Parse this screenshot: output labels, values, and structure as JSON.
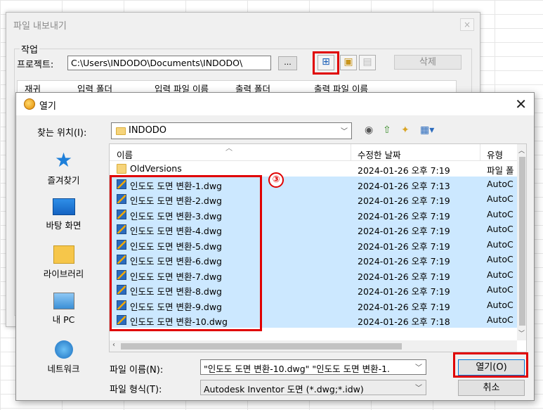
{
  "export_dialog": {
    "title": "파일 내보내기",
    "close_symbol": "×",
    "group_label": "작업",
    "project_label": "프로젝트:",
    "project_path": "C:\\Users\\INDODO\\Documents\\INDODO\\",
    "browse_label": "...",
    "delete_label": "삭제",
    "columns": [
      "재귀",
      "입력 폴더",
      "입력 파일 이름",
      "출력 폴더",
      "출력 파일 이름"
    ]
  },
  "open_dialog": {
    "title": "열기",
    "close_symbol": "✕",
    "lookin_label": "찾는 위치(I):",
    "lookin_value": "INDODO",
    "places": [
      {
        "label": "즐겨찾기",
        "icon": "star-icon"
      },
      {
        "label": "바탕 화면",
        "icon": "desktop-icon"
      },
      {
        "label": "라이브러리",
        "icon": "library-icon"
      },
      {
        "label": "내 PC",
        "icon": "computer-icon"
      },
      {
        "label": "네트워크",
        "icon": "network-icon"
      }
    ],
    "columns": {
      "name": "이름",
      "date": "수정한 날짜",
      "type": "유형"
    },
    "files": [
      {
        "name": "OldVersions",
        "date": "2024-01-26 오후 7:19",
        "type": "파일 폴",
        "kind": "folder",
        "selected": false
      },
      {
        "name": "인도도 도면 변환-1.dwg",
        "date": "2024-01-26 오후 7:13",
        "type": "AutoC",
        "kind": "dwg",
        "selected": true
      },
      {
        "name": "인도도 도면 변환-2.dwg",
        "date": "2024-01-26 오후 7:19",
        "type": "AutoC",
        "kind": "dwg",
        "selected": true
      },
      {
        "name": "인도도 도면 변환-3.dwg",
        "date": "2024-01-26 오후 7:19",
        "type": "AutoC",
        "kind": "dwg",
        "selected": true
      },
      {
        "name": "인도도 도면 변환-4.dwg",
        "date": "2024-01-26 오후 7:19",
        "type": "AutoC",
        "kind": "dwg",
        "selected": true
      },
      {
        "name": "인도도 도면 변환-5.dwg",
        "date": "2024-01-26 오후 7:19",
        "type": "AutoC",
        "kind": "dwg",
        "selected": true
      },
      {
        "name": "인도도 도면 변환-6.dwg",
        "date": "2024-01-26 오후 7:19",
        "type": "AutoC",
        "kind": "dwg",
        "selected": true
      },
      {
        "name": "인도도 도면 변환-7.dwg",
        "date": "2024-01-26 오후 7:19",
        "type": "AutoC",
        "kind": "dwg",
        "selected": true
      },
      {
        "name": "인도도 도면 변환-8.dwg",
        "date": "2024-01-26 오후 7:19",
        "type": "AutoC",
        "kind": "dwg",
        "selected": true
      },
      {
        "name": "인도도 도면 변환-9.dwg",
        "date": "2024-01-26 오후 7:19",
        "type": "AutoC",
        "kind": "dwg",
        "selected": true
      },
      {
        "name": "인도도 도면 변환-10.dwg",
        "date": "2024-01-26 오후 7:18",
        "type": "AutoC",
        "kind": "dwg",
        "selected": true
      }
    ],
    "filename_label": "파일 이름(N):",
    "filename_value": "\"인도도 도면 변환-10.dwg\" \"인도도 도면 변환-1.",
    "filetype_label": "파일 형식(T):",
    "filetype_value": "Autodesk Inventor 도면 (*.dwg;*.idw)",
    "open_label": "열기(O)",
    "cancel_label": "취소"
  },
  "annotation": {
    "step_number": "③",
    "highlight_color": "#e00000"
  }
}
